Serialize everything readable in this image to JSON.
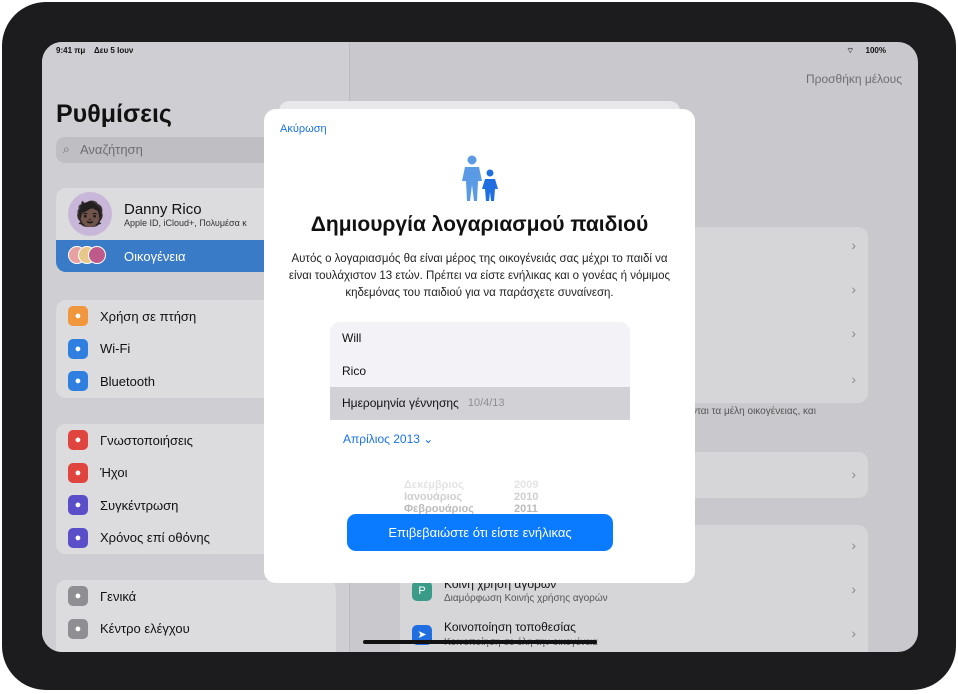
{
  "status": {
    "time": "9:41 πμ",
    "date": "Δευ 5 Ιουν",
    "battery": "100%"
  },
  "sidebar": {
    "title": "Ρυθμίσεις",
    "search_placeholder": "Αναζήτηση",
    "profile": {
      "name": "Danny Rico",
      "subtitle": "Apple ID, iCloud+, Πολυμέσα κ"
    },
    "family": "Οικογένεια",
    "group1": [
      {
        "label": "Χρήση σε πτήση",
        "icon": "airplane-icon",
        "color": "#f0963c"
      },
      {
        "label": "Wi-Fi",
        "icon": "wifi-icon",
        "color": "#2f7fe0"
      },
      {
        "label": "Bluetooth",
        "icon": "bluetooth-icon",
        "color": "#2f7fe0"
      }
    ],
    "group2": [
      {
        "label": "Γνωστοποιήσεις",
        "icon": "bell-icon",
        "color": "#e0443e"
      },
      {
        "label": "Ήχοι",
        "icon": "speaker-icon",
        "color": "#e0443e"
      },
      {
        "label": "Συγκέντρωση",
        "icon": "moon-icon",
        "color": "#5a4fc8"
      },
      {
        "label": "Χρόνος επί οθόνης",
        "icon": "hourglass-icon",
        "color": "#5a4fc8"
      }
    ],
    "group3": [
      {
        "label": "Γενικά",
        "icon": "gear-icon",
        "color": "#8e8e93"
      },
      {
        "label": "Κέντρο ελέγχου",
        "icon": "toggles-icon",
        "color": "#8e8e93"
      }
    ]
  },
  "detail": {
    "add_member": "Προσθήκη μέλους",
    "footnote": "νται τα μέλη οικογένειας, και",
    "purchase_title": "Κοινή χρήση αγορών",
    "purchase_sub": "Διαμόρφωση Κοινής χρήσης αγορών",
    "location_title": "Κοινοποίηση τοποθεσίας",
    "location_sub": "Κοινοποίηση σε όλη την οικογένεια"
  },
  "modal": {
    "cancel": "Ακύρωση",
    "icon": "parent-child-icon",
    "title": "Δημιουργία λογαριασμού παιδιού",
    "description": "Αυτός ο λογαριασμός θα είναι μέρος της οικογένειάς σας μέχρι το παιδί να είναι τουλάχιστον 13 ετών. Πρέπει να είστε ενήλικας και ο γονέας ή νόμιμος κηδεμόνας του παιδιού για να παράσχετε συναίνεση.",
    "first_name": "Will",
    "last_name": "Rico",
    "birthdate_label": "Ημερομηνία γέννησης",
    "birthdate_value": "10/4/13",
    "month_picker": "Απρίλιος 2013",
    "wheel": [
      [
        "Δεκέμβριος",
        "2009"
      ],
      [
        "Ιανουάριος",
        "2010"
      ],
      [
        "Φεβρουάριος",
        "2011"
      ]
    ],
    "confirm": "Επιβεβαιώστε ότι είστε ενήλικας"
  },
  "colors": {
    "accent": "#0a7aff",
    "selected": "#3a7bc8"
  }
}
